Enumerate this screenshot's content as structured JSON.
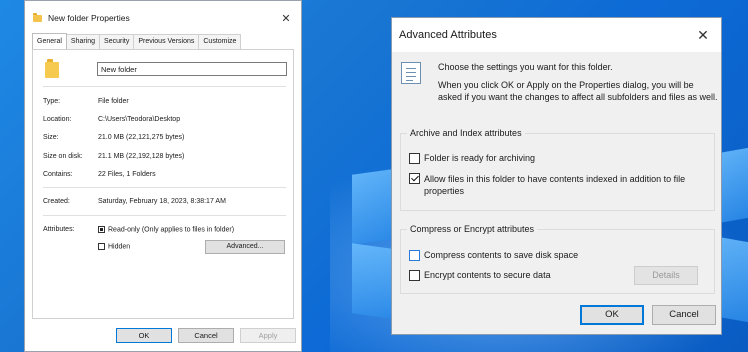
{
  "properties": {
    "title": "New folder Properties",
    "tabs": [
      "General",
      "Sharing",
      "Security",
      "Previous Versions",
      "Customize"
    ],
    "folder_name": "New folder",
    "fields": [
      {
        "label": "Type:",
        "value": "File folder"
      },
      {
        "label": "Location:",
        "value": "C:\\Users\\Teodora\\Desktop"
      },
      {
        "label": "Size:",
        "value": "21.0 MB (22,121,275 bytes)"
      },
      {
        "label": "Size on disk:",
        "value": "21.1 MB (22,192,128 bytes)"
      },
      {
        "label": "Contains:",
        "value": "22 Files, 1 Folders"
      },
      {
        "label": "Created:",
        "value": "Saturday, February 18, 2023, 8:38:17 AM"
      }
    ],
    "attributes_label": "Attributes:",
    "readonly_label": "Read-only (Only applies to files in folder)",
    "hidden_label": "Hidden",
    "advanced_button": "Advanced...",
    "ok": "OK",
    "cancel": "Cancel",
    "apply": "Apply"
  },
  "advanced": {
    "title": "Advanced Attributes",
    "intro": "Choose the settings you want for this folder.",
    "intro_detail": "When you click OK or Apply on the Properties dialog, you will be asked if you want the changes to affect all subfolders and files as well.",
    "archive_group": "Archive and Index attributes",
    "archive_option": "Folder is ready for archiving",
    "index_option": "Allow files in this folder to have contents indexed in addition to file properties",
    "compress_group": "Compress or Encrypt attributes",
    "compress_option": "Compress contents to save disk space",
    "encrypt_option": "Encrypt contents to secure data",
    "details_button": "Details",
    "ok": "OK",
    "cancel": "Cancel"
  },
  "colors": {
    "accent": "#0078d7",
    "desktop": "#1976d2",
    "folder": "#f3c34b"
  }
}
